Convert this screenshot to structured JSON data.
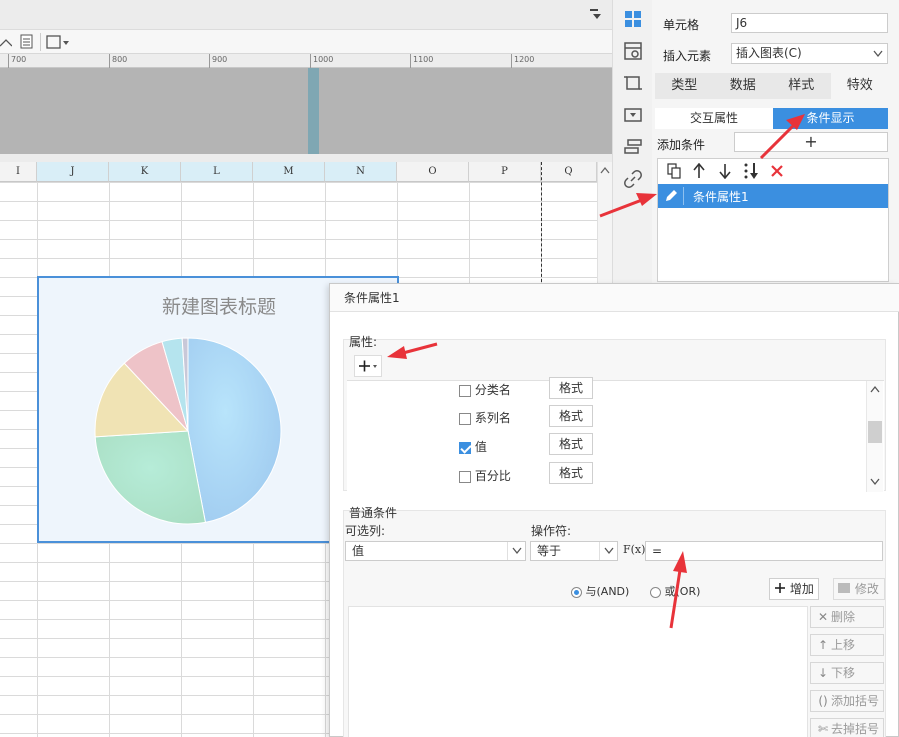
{
  "ruler_ticks": [
    "700",
    "800",
    "900",
    "1000",
    "1100",
    "1200"
  ],
  "columns": [
    "I",
    "J",
    "K",
    "L",
    "M",
    "N",
    "O",
    "P",
    "Q"
  ],
  "chart": {
    "title": "新建图表标题"
  },
  "chart_data": {
    "type": "pie",
    "title": "新建图表标题",
    "values": [
      47,
      27,
      14,
      7.5,
      3.5,
      1
    ],
    "colors": [
      "#a6d5f2",
      "#ace2c3",
      "#f0e3b4",
      "#eec3c8",
      "#b5e4ee",
      "#c8c8d8"
    ]
  },
  "panel": {
    "cell_label": "单元格",
    "cell_value": "J6",
    "insert_label": "插入元素",
    "insert_value": "插入图表(C)",
    "tabs": [
      "类型",
      "数据",
      "样式",
      "特效"
    ],
    "subtab_interactive": "交互属性",
    "subtab_condition": "条件显示",
    "add_condition_label": "添加条件",
    "add_button": "+",
    "condition_item": "条件属性1"
  },
  "dialog": {
    "title": "条件属性1",
    "property_label": "属性:",
    "properties": [
      {
        "label": "分类名",
        "checked": false,
        "button": "格式"
      },
      {
        "label": "系列名",
        "checked": false,
        "button": "格式"
      },
      {
        "label": "值",
        "checked": true,
        "button": "格式"
      },
      {
        "label": "百分比",
        "checked": false,
        "button": "格式"
      }
    ],
    "normal_condition_label": "普通条件",
    "optional_column_label": "可选列:",
    "operator_label": "操作符:",
    "column_value": "值",
    "operator_value": "等于",
    "formula_icon": "F(x)",
    "formula_value": "=",
    "and_label": "与(AND)",
    "or_label": "或(OR)",
    "add_btn": "增加",
    "modify_btn": "修改",
    "delete_btn": "删除",
    "moveup_btn": "上移",
    "movedown_btn": "下移",
    "addbracket_btn": "添加括号",
    "removebracket_btn": "去掉括号"
  }
}
